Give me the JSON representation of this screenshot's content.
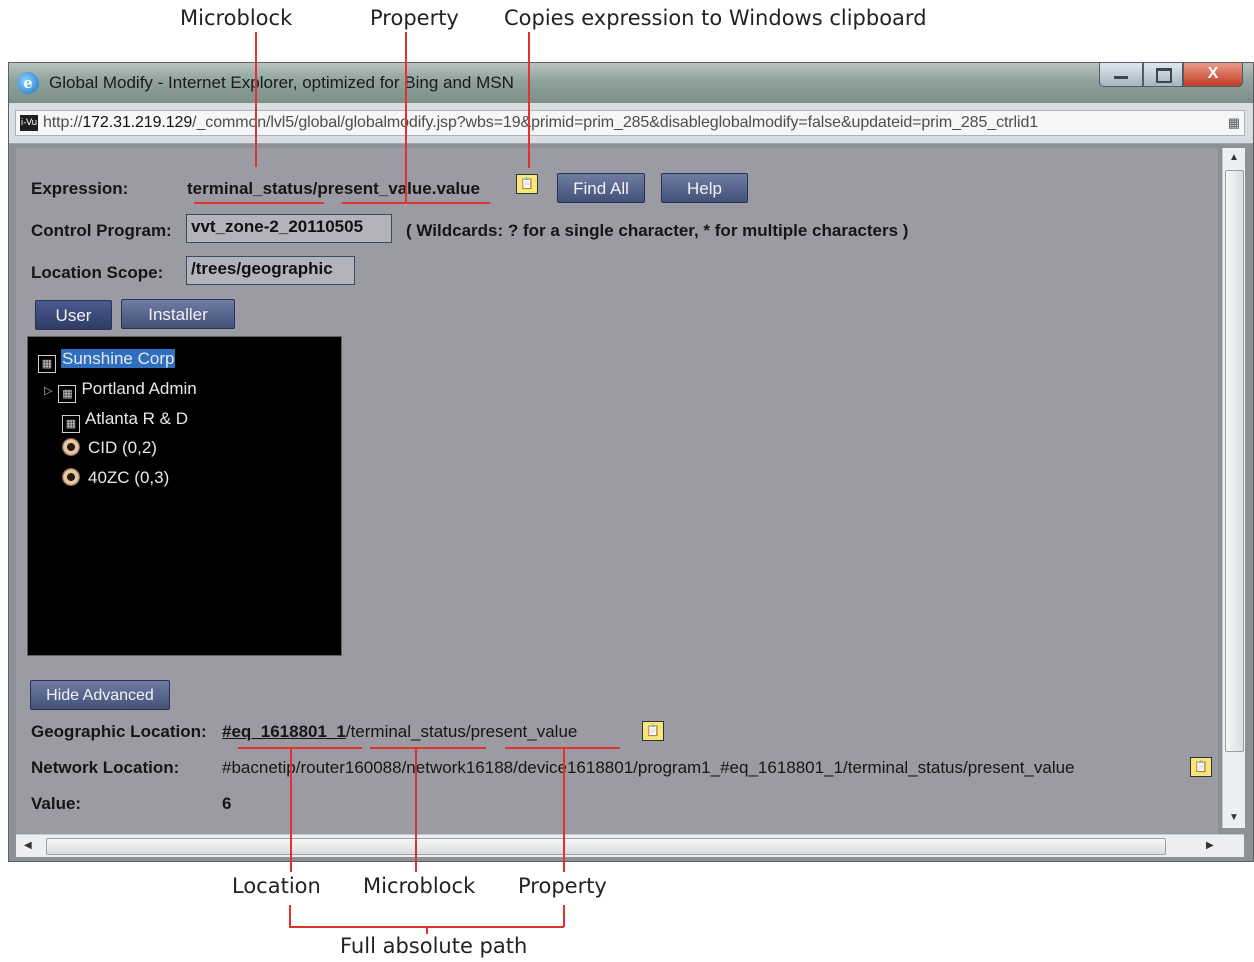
{
  "callouts": {
    "top": {
      "microblock": "Microblock",
      "property": "Property",
      "copies": "Copies expression to Windows clipboard"
    },
    "bottom": {
      "location": "Location",
      "microblock": "Microblock",
      "property": "Property",
      "full_path": "Full absolute path"
    }
  },
  "window": {
    "title": "Global Modify - Internet Explorer, optimized for Bing and MSN",
    "url_prefix": "http://",
    "url_host": "172.31.219.129",
    "url_rest": "/_common/lvl5/global/globalmodify.jsp?wbs=19&primid=prim_285&disableglobalmodify=false&updateid=prim_285_ctrlid1",
    "close_glyph": "X"
  },
  "form": {
    "expression_label": "Expression:",
    "expression_value": "terminal_status/present_value.value",
    "find_all": "Find All",
    "help": "Help",
    "control_program_label": "Control Program:",
    "control_program_value": "vvt_zone-2_20110505",
    "wildcards_note": "( Wildcards: ? for a single character, * for multiple characters )",
    "location_scope_label": "Location Scope:",
    "location_scope_value": "/trees/geographic",
    "tab_user": "User",
    "tab_installer": "Installer"
  },
  "tree": {
    "root": "Sunshine Corp",
    "items": [
      "Portland Admin",
      "Atlanta R & D",
      "CID (0,2)",
      "40ZC (0,3)"
    ]
  },
  "advanced": {
    "hide_advanced": "Hide Advanced",
    "geo_label": "Geographic Location:",
    "geo_location_part": "#eq_1618801_1",
    "geo_rest": "/terminal_status/present_value",
    "network_label": "Network Location:",
    "network_value": "#bacnetip/router160088/network16188/device1618801/program1_#eq_1618801_1/terminal_status/present_value",
    "value_label": "Value:",
    "value": "6"
  },
  "icons": {
    "browser": "internet-explorer-icon",
    "clipboard": "clipboard-icon",
    "tree_folder": "tree-node-icon",
    "device": "device-icon"
  },
  "colors": {
    "annotation": "#e0322e",
    "panel": "#9b9ba4",
    "button": "#4d5a82",
    "tree_bg": "#000000"
  }
}
